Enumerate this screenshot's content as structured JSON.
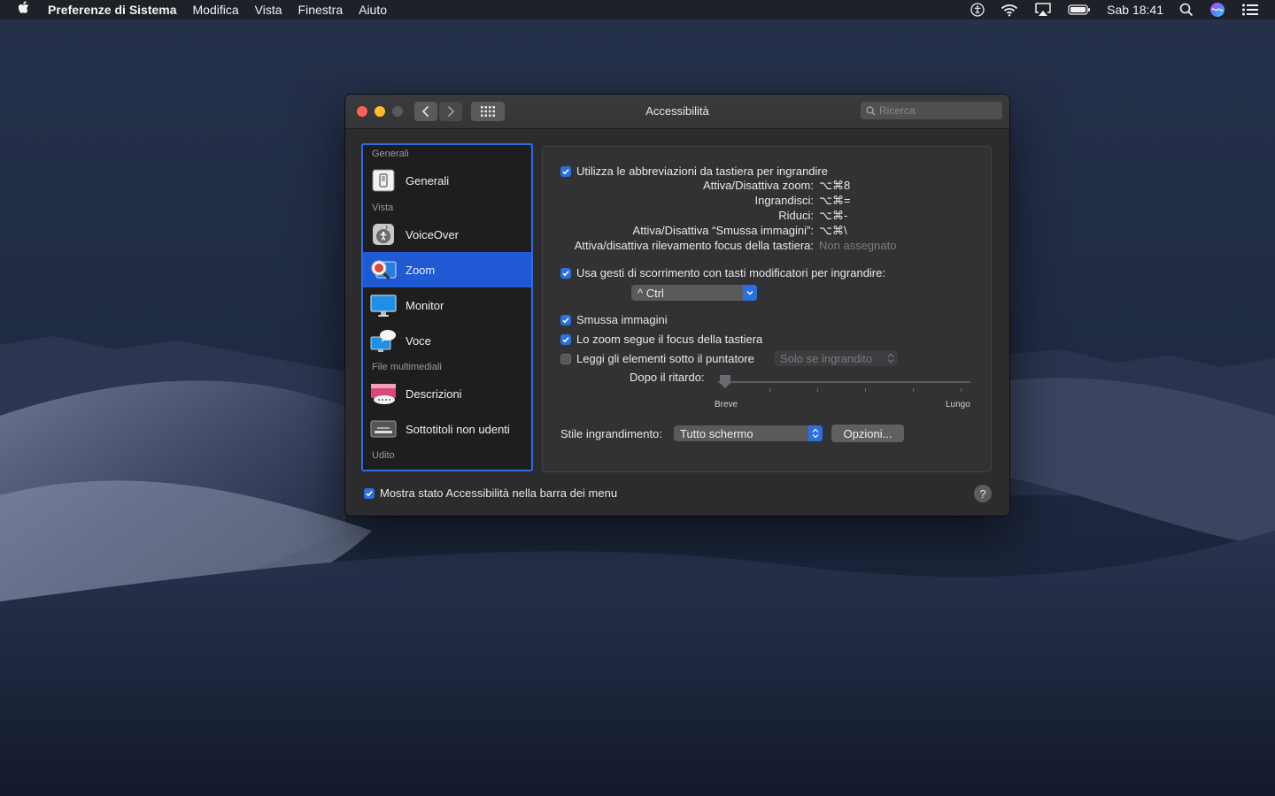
{
  "menubar": {
    "app_name": "Preferenze di Sistema",
    "menus": [
      "Modifica",
      "Vista",
      "Finestra",
      "Aiuto"
    ],
    "clock": "Sab 18:41"
  },
  "window": {
    "title": "Accessibilità",
    "search_placeholder": "Ricerca"
  },
  "sidebar": {
    "sections": [
      {
        "header": "Generali",
        "items": [
          {
            "label": "Generali",
            "icon": "general-icon"
          }
        ]
      },
      {
        "header": "Vista",
        "items": [
          {
            "label": "VoiceOver",
            "icon": "voiceover-icon"
          },
          {
            "label": "Zoom",
            "icon": "zoom-icon",
            "selected": true
          },
          {
            "label": "Monitor",
            "icon": "monitor-icon"
          },
          {
            "label": "Voce",
            "icon": "speech-icon"
          }
        ]
      },
      {
        "header": "File multimediali",
        "items": [
          {
            "label": "Descrizioni",
            "icon": "descriptions-icon"
          },
          {
            "label": "Sottotitoli non udenti",
            "icon": "captions-icon"
          }
        ]
      },
      {
        "header": "Udito",
        "items": []
      }
    ]
  },
  "zoom": {
    "shortcuts_checkbox": "Utilizza le abbreviazioni da tastiera per ingrandire",
    "shortcuts_checked": true,
    "shortcuts": [
      {
        "label": "Attiva/Disattiva zoom:",
        "value": "⌥⌘8"
      },
      {
        "label": "Ingrandisci:",
        "value": "⌥⌘="
      },
      {
        "label": "Riduci:",
        "value": "⌥⌘-"
      },
      {
        "label": "Attiva/Disattiva “Smussa immagini”:",
        "value": "⌥⌘\\"
      },
      {
        "label": "Attiva/disattiva rilevamento focus della tastiera:",
        "value": "Non assegnato"
      }
    ],
    "scroll_checkbox": "Usa gesti di scorrimento con tasti modificatori per ingrandire:",
    "scroll_checked": true,
    "modifier_value": "^ Ctrl",
    "smooth_checkbox": "Smussa immagini",
    "smooth_checked": true,
    "focus_checkbox": "Lo zoom segue il focus della tastiera",
    "focus_checked": true,
    "speak_checkbox": "Leggi gli elementi sotto il puntatore",
    "speak_checked": false,
    "speak_mode": "Solo se ingrandito",
    "delay_label": "Dopo il ritardo:",
    "delay_min": "Breve",
    "delay_max": "Lungo",
    "delay_value": 0,
    "style_label": "Stile ingrandimento:",
    "style_value": "Tutto schermo",
    "options_button": "Opzioni..."
  },
  "footer": {
    "status_checkbox": "Mostra stato Accessibilità nella barra dei menu",
    "status_checked": true,
    "help": "?"
  },
  "colors": {
    "accent": "#2b6fe0",
    "selection": "#1f5ad4"
  }
}
